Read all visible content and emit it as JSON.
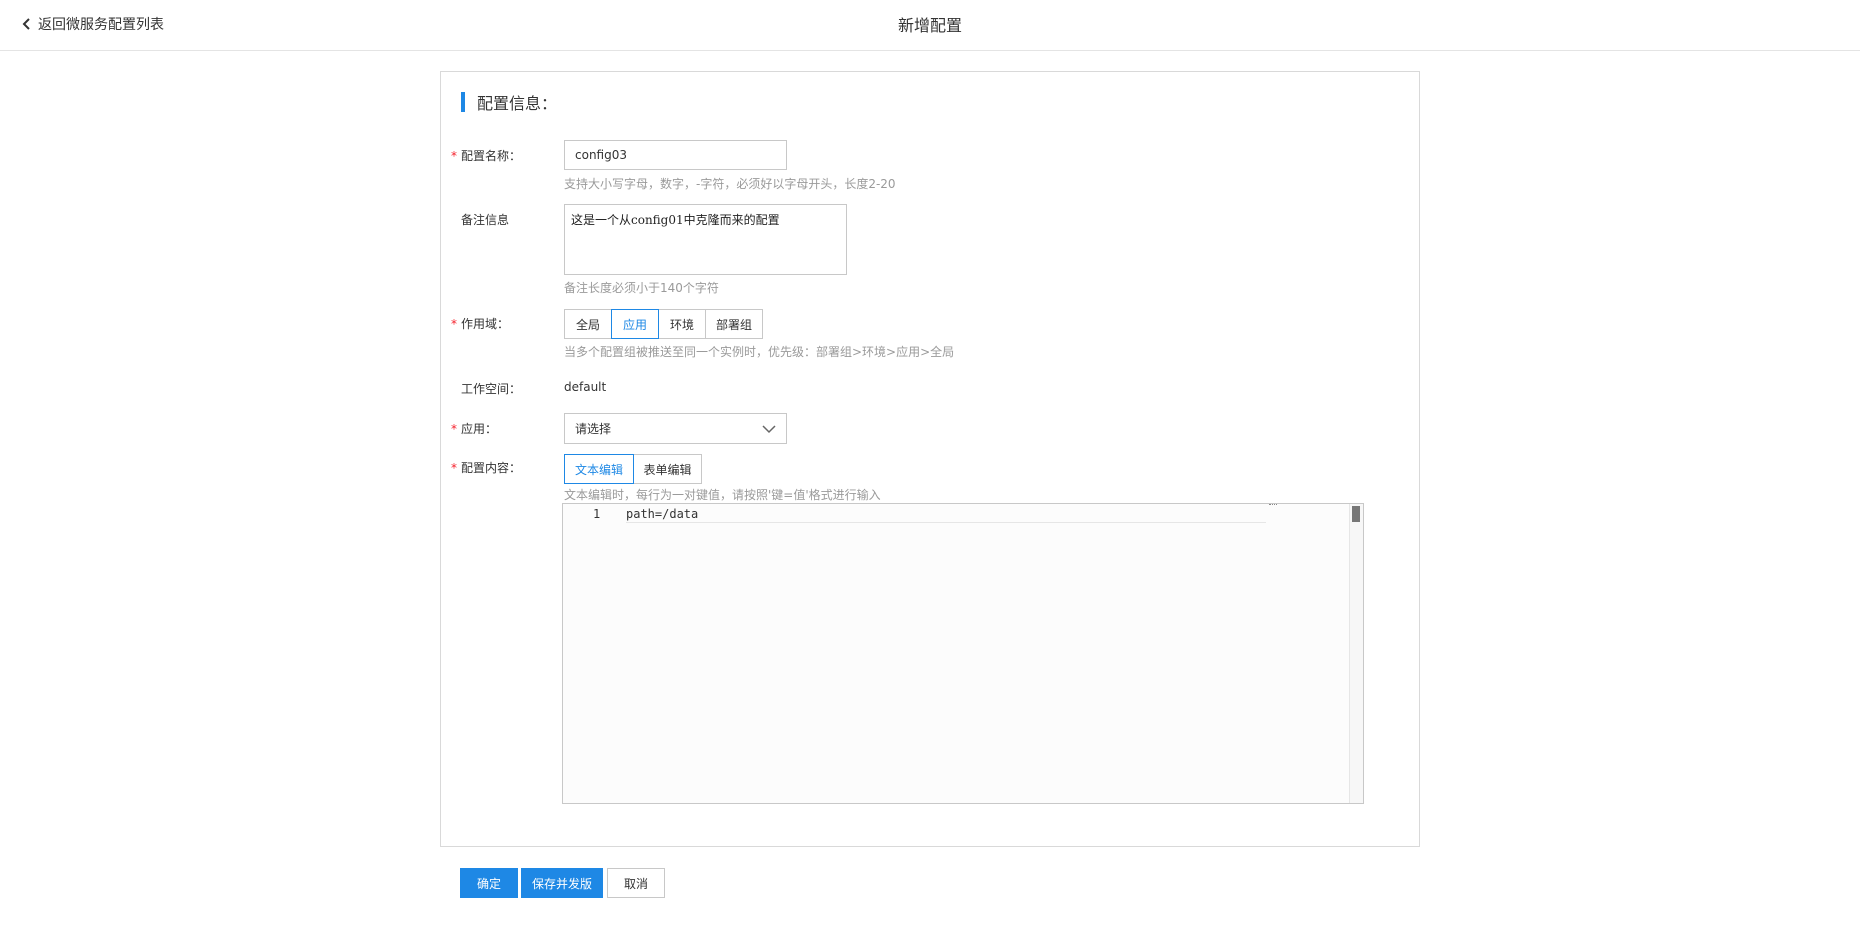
{
  "header": {
    "back_label": "返回微服务配置列表",
    "title": "新增配置"
  },
  "section": {
    "title": "配置信息："
  },
  "form": {
    "name": {
      "required_mark": "*",
      "label": "配置名称：",
      "value": "config03",
      "hint": "支持大小写字母，数字，-字符，必须好以字母开头，长度2-20"
    },
    "remark": {
      "label": "备注信息",
      "value": "这是一个从config01中克隆而来的配置",
      "hint": "备注长度必须小于140个字符"
    },
    "scope": {
      "required_mark": "*",
      "label": "作用域：",
      "options": [
        "全局",
        "应用",
        "环境",
        "部署组"
      ],
      "selected": "应用",
      "hint": "当多个配置组被推送至同一个实例时，优先级：部署组>环境>应用>全局"
    },
    "workspace": {
      "label": "工作空间：",
      "value": "default"
    },
    "app": {
      "required_mark": "*",
      "label": "应用：",
      "placeholder": "请选择"
    },
    "content": {
      "required_mark": "*",
      "label": "配置内容：",
      "modes": [
        "文本编辑",
        "表单编辑"
      ],
      "selected_mode": "文本编辑",
      "hint": "文本编辑时，每行为一对键值，请按照'键=值'格式进行输入",
      "editor": {
        "lines": [
          {
            "number": "1",
            "text": "path=/data"
          }
        ]
      }
    }
  },
  "actions": {
    "confirm": "确定",
    "save_publish": "保存并发版",
    "cancel": "取消"
  },
  "colors": {
    "accent": "#1e88e5",
    "required": "#f5222d",
    "hint": "#9a9a9a",
    "border": "#c8c8c8"
  },
  "icons": {
    "back": "chevron-left-icon",
    "select": "chevron-down-icon"
  }
}
